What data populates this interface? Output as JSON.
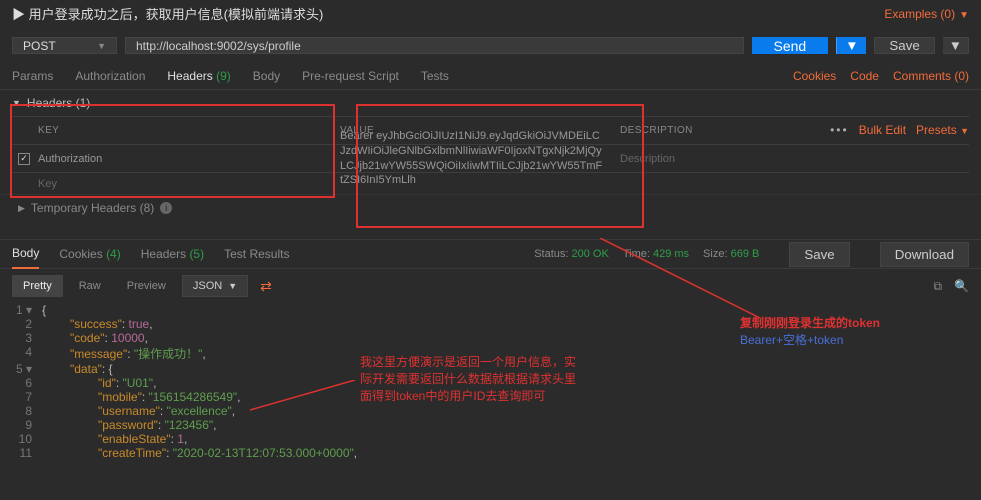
{
  "header": {
    "request_title": "用户登录成功之后，获取用户信息(模拟前端请求头)",
    "examples_label": "Examples (0)"
  },
  "request": {
    "method": "POST",
    "url": "http://localhost:9002/sys/profile",
    "send_label": "Send",
    "save_label": "Save"
  },
  "req_tabs": {
    "params": "Params",
    "auth": "Authorization",
    "headers": "Headers",
    "headers_count": "(9)",
    "body": "Body",
    "prs": "Pre-request Script",
    "tests": "Tests",
    "cookies": "Cookies",
    "code": "Code",
    "comments": "Comments (0)"
  },
  "headers_section": {
    "title": "Headers (1)",
    "col_key": "KEY",
    "col_value": "VALUE",
    "col_desc": "DESCRIPTION",
    "bulk": "Bulk Edit",
    "presets": "Presets",
    "rows": [
      {
        "key": "Authorization",
        "value": "Bearer eyJhbGciOiJIUzI1NiJ9.eyJqdGkiOiJVMDEiLCJzdWIiOiJleGNlbGxlbmNlIiwiaWF0IjoxNTgxNjk2MjQyLCJjb21wYW55SWQiOiIxIiwMTIiLCJjb21wYW55TmFtZSI6InI5YmLlh",
        "desc": ""
      }
    ],
    "placeholder_key": "Key",
    "placeholder_desc": "Description",
    "temp_headers": "Temporary Headers (8)"
  },
  "annotations": {
    "right_line1": "复制刚刚登录生成的token",
    "right_line2": "Bearer+空格+token",
    "body_note_l1": "我这里方便演示是返回一个用户信息，实",
    "body_note_l2": "际开发需要返回什么数据就根据请求头里",
    "body_note_l3": "面得到token中的用户ID去查询即可"
  },
  "response": {
    "tabs": {
      "body": "Body",
      "cookies": "Cookies",
      "cookies_cnt": "(4)",
      "headers": "Headers",
      "headers_cnt": "(5)",
      "tests": "Test Results"
    },
    "status_label": "Status:",
    "status_value": "200 OK",
    "time_label": "Time:",
    "time_value": "429 ms",
    "size_label": "Size:",
    "size_value": "669 B",
    "save_btn": "Save",
    "download_btn": "Download"
  },
  "body_bar": {
    "pretty": "Pretty",
    "raw": "Raw",
    "preview": "Preview",
    "format": "JSON"
  },
  "chart_data": {
    "type": "table",
    "success": true,
    "code": 10000,
    "message": "操作成功！",
    "data": {
      "id": "U01",
      "mobile": "156154286549",
      "username": "excellence",
      "password": "123456",
      "enableState": 1,
      "createTime": "2020-02-13T12:07:53.000+0000"
    }
  }
}
